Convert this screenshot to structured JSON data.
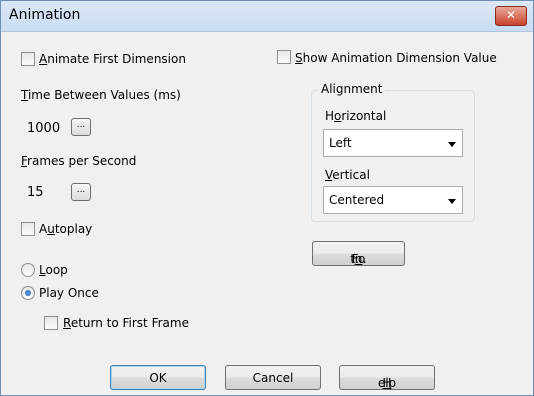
{
  "window": {
    "title": "Animation",
    "close_icon": "close-icon"
  },
  "animate_first_dimension": {
    "mnemonic": "A",
    "rest": "nimate First Dimension",
    "checked": false
  },
  "show_animation_dimension_value": {
    "mnemonic": "S",
    "rest": "how Animation Dimension Value",
    "checked": false
  },
  "time_between_values": {
    "mnemonic": "T",
    "rest": "ime Between Values (ms)",
    "value": "1000",
    "browse": "..."
  },
  "frames_per_second": {
    "mnemonic": "F",
    "rest": "rames per Second",
    "value": "15",
    "browse": "..."
  },
  "autoplay": {
    "pre": "A",
    "mnemonic": "u",
    "rest": "toplay",
    "checked": false
  },
  "playback": {
    "loop": {
      "mnemonic": "L",
      "rest": "oop",
      "selected": false
    },
    "play_once": {
      "label": "Play Once",
      "selected": true
    },
    "return_to_first_frame": {
      "mnemonic": "R",
      "rest": "eturn to First Frame",
      "checked": false
    }
  },
  "alignment": {
    "title": "Alignment",
    "horizontal": {
      "pre": "H",
      "mnemonic": "o",
      "rest": "rizontal",
      "value": "Left"
    },
    "vertical": {
      "mnemonic": "V",
      "rest": "ertical",
      "value": "Centered"
    }
  },
  "font_button": {
    "pre": "Fo",
    "mnemonic": "n",
    "rest": "t..."
  },
  "buttons": {
    "ok": "OK",
    "cancel": "Cancel",
    "help_mnemonic": "H",
    "help_rest": "elp"
  }
}
